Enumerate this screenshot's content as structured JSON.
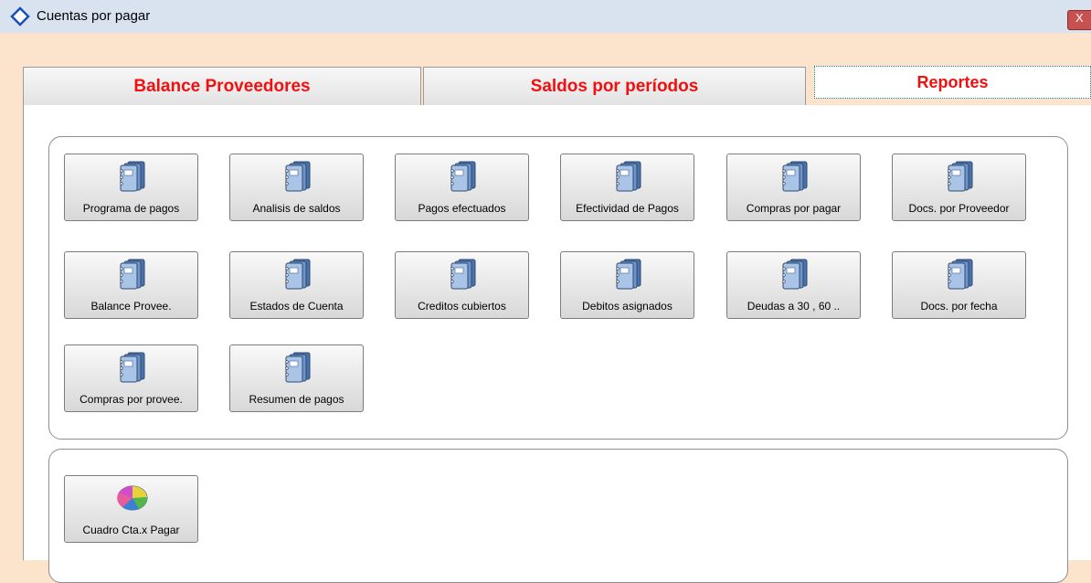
{
  "window": {
    "title": "Cuentas por pagar",
    "close_label": "X"
  },
  "tabs": [
    {
      "label": "Balance Proveedores",
      "active": false
    },
    {
      "label": "Saldos por períodos",
      "active": false
    },
    {
      "label": "Reportes",
      "active": true
    }
  ],
  "reports": [
    {
      "label": "Programa de pagos",
      "icon": "binder-icon"
    },
    {
      "label": "Analisis de saldos",
      "icon": "binder-icon"
    },
    {
      "label": "Pagos efectuados",
      "icon": "binder-icon"
    },
    {
      "label": "Efectividad de Pagos",
      "icon": "binder-icon"
    },
    {
      "label": "Compras por pagar",
      "icon": "binder-icon"
    },
    {
      "label": "Docs. por  Proveedor",
      "icon": "binder-icon"
    },
    {
      "label": "Balance Provee.",
      "icon": "binder-icon"
    },
    {
      "label": "Estados de Cuenta",
      "icon": "binder-icon"
    },
    {
      "label": "Creditos cubiertos",
      "icon": "binder-icon"
    },
    {
      "label": "Debitos asignados",
      "icon": "binder-icon"
    },
    {
      "label": "Deudas a 30 , 60 ..",
      "icon": "binder-icon"
    },
    {
      "label": "Docs. por fecha",
      "icon": "binder-icon"
    },
    {
      "label": "Compras por provee.",
      "icon": "binder-icon"
    },
    {
      "label": "Resumen de pagos",
      "icon": "binder-icon"
    }
  ],
  "charts_group": {
    "buttons": [
      {
        "label": "Cuadro Cta.x Pagar",
        "icon": "pie-chart-icon"
      }
    ]
  },
  "colors": {
    "tab_text": "#f01010",
    "background": "#fce4cc",
    "titlebar": "#d9e3f0"
  }
}
